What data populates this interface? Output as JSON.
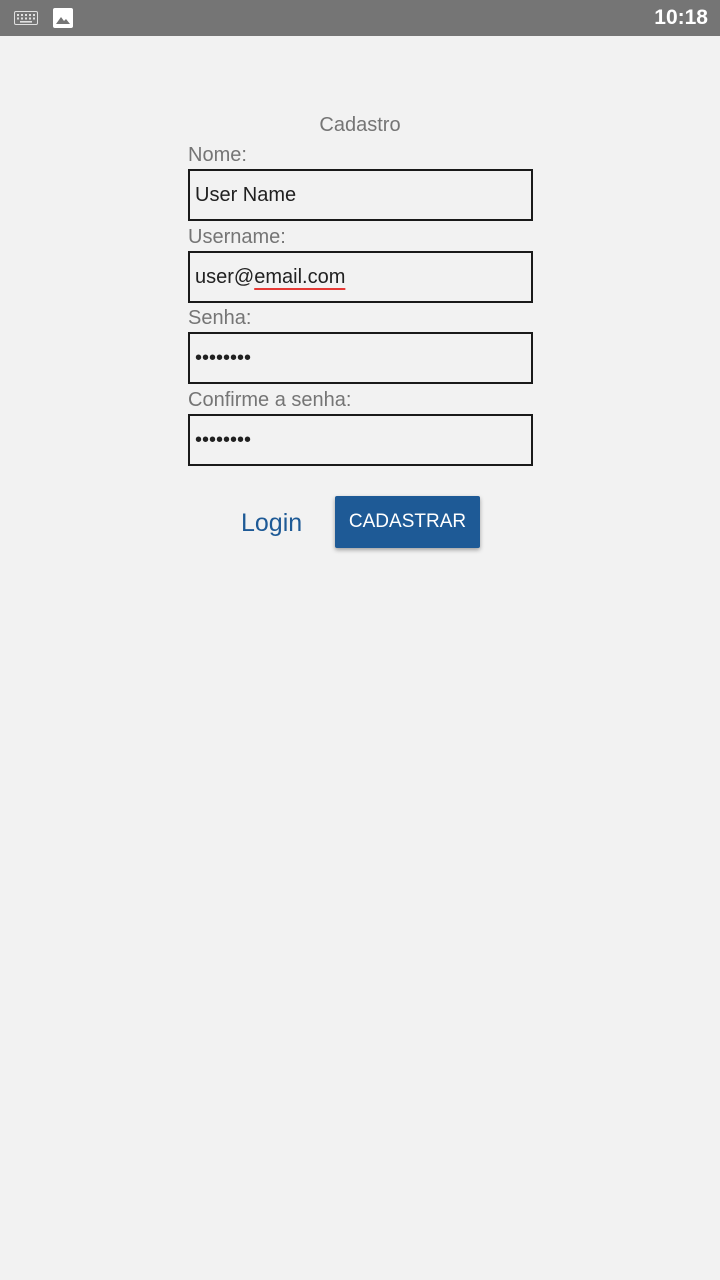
{
  "status_bar": {
    "time": "10:18",
    "icons": [
      "keyboard-icon",
      "image-icon"
    ]
  },
  "form": {
    "title": "Cadastro",
    "nome": {
      "label": "Nome:",
      "value": "User Name"
    },
    "username": {
      "label": "Username:",
      "value_user": "user@",
      "value_domain": "email.com"
    },
    "senha": {
      "label": "Senha:",
      "value": "••••••••"
    },
    "confirme": {
      "label": "Confirme a senha:",
      "value": "••••••••"
    }
  },
  "actions": {
    "login_label": "Login",
    "cadastrar_label": "CADASTRAR"
  },
  "colors": {
    "accent": "#1e5a96",
    "status_bar": "#757575",
    "background": "#f2f2f2",
    "spellcheck_underline": "#e53935"
  }
}
